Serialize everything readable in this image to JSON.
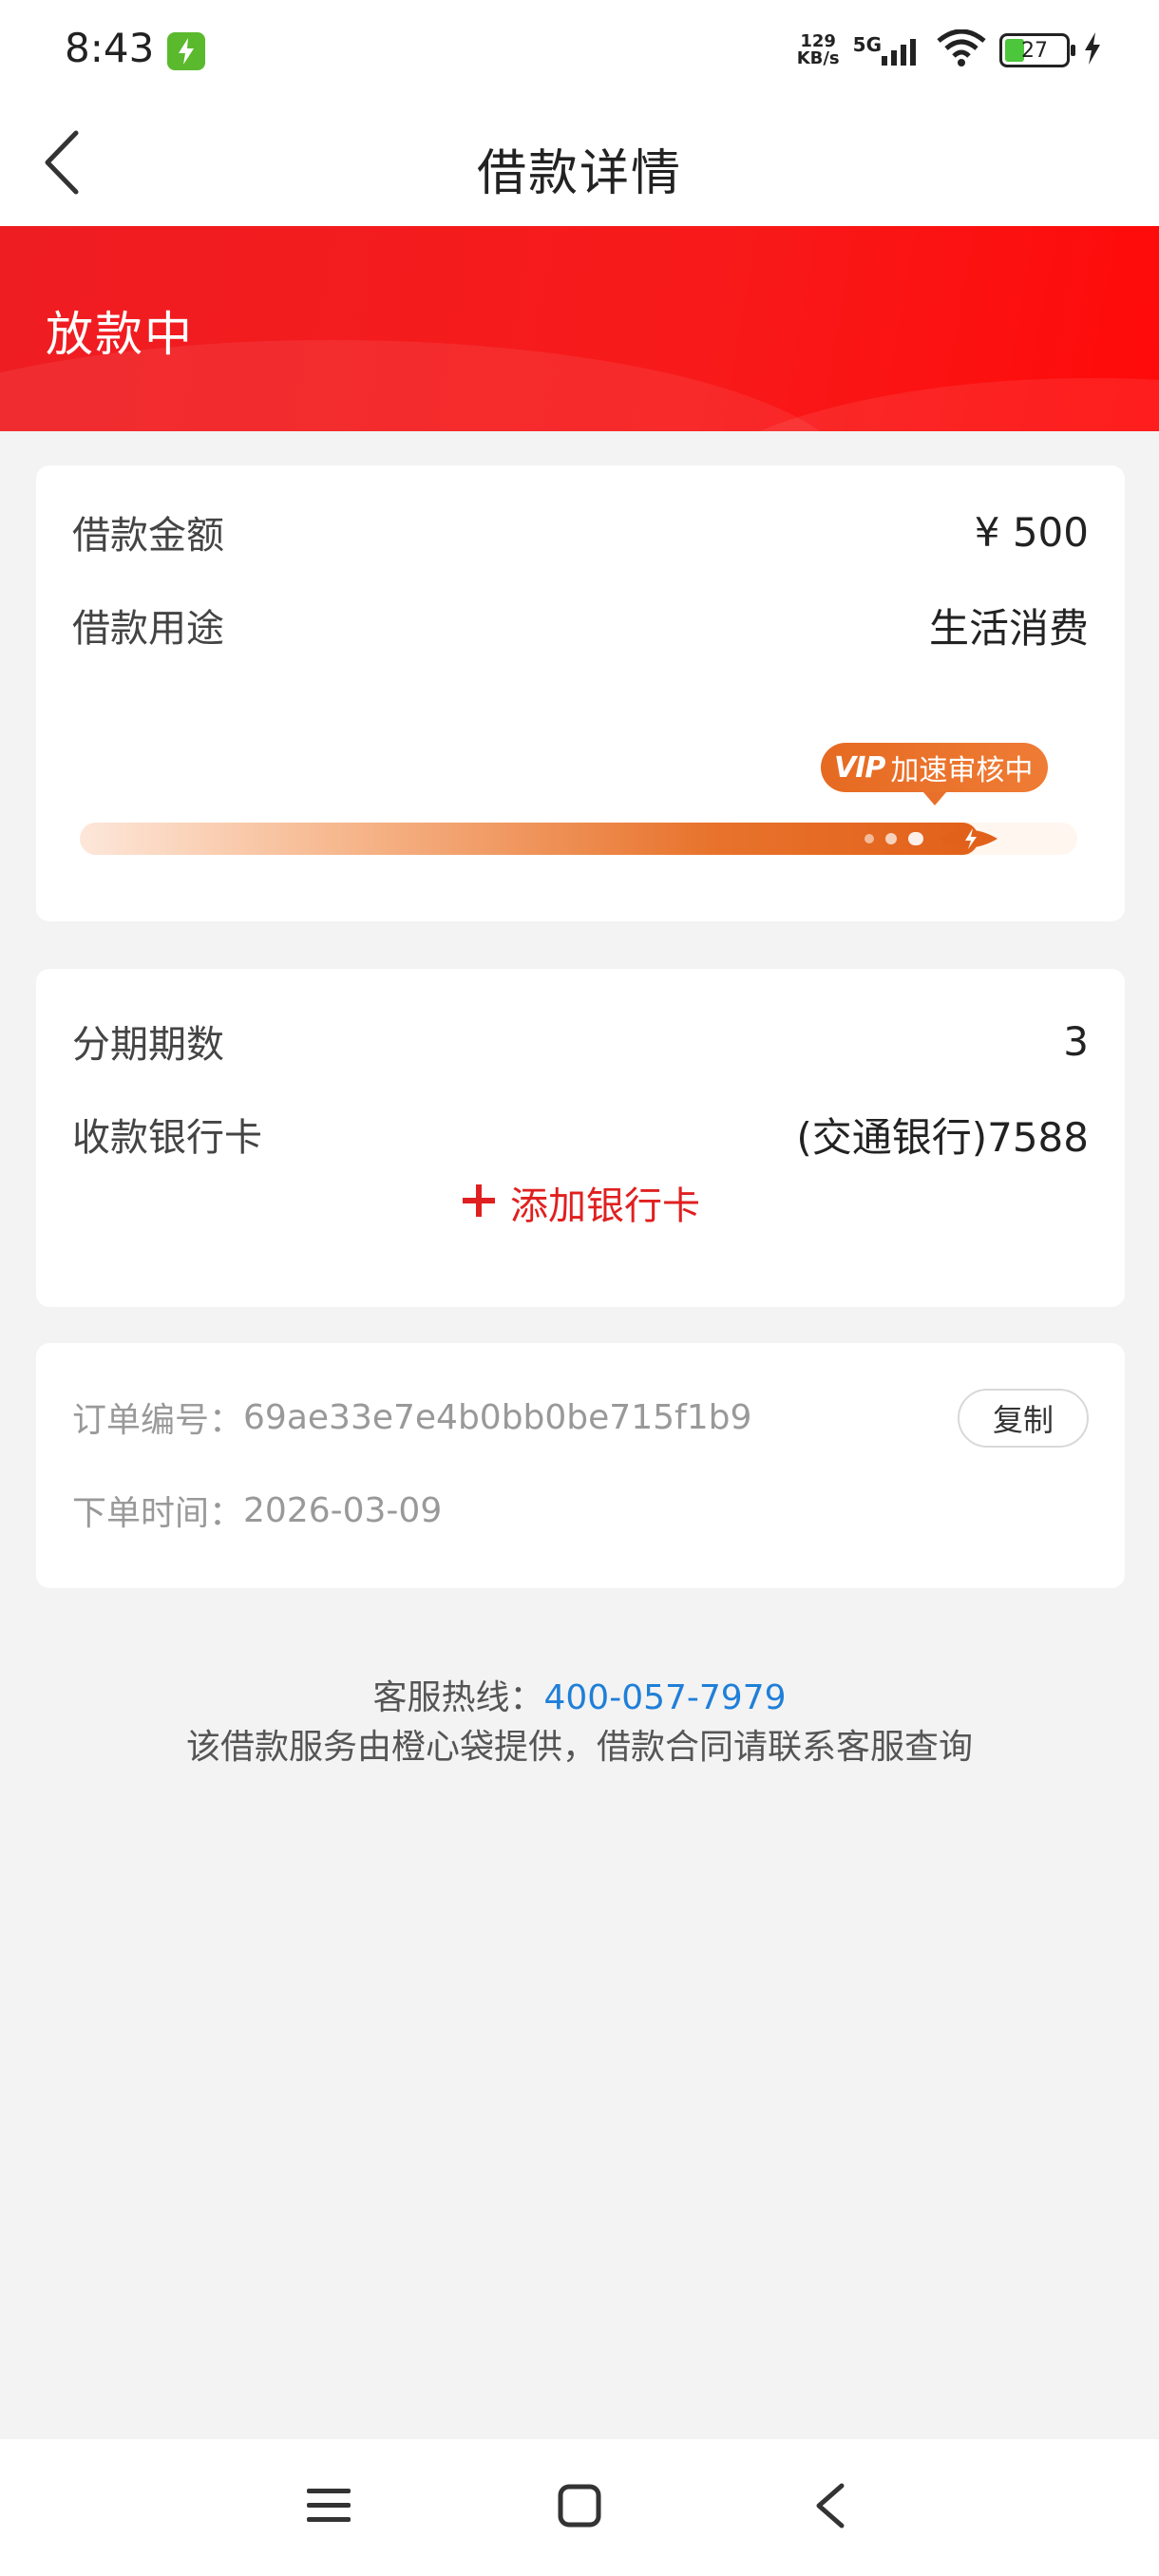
{
  "status_bar": {
    "time": "8:43",
    "net_speed_value": "129",
    "net_speed_unit": "KB/s",
    "network_type": "5G",
    "battery_level": "27",
    "icons": [
      "charging-app-icon",
      "signal-icon",
      "wifi-icon",
      "battery-icon",
      "charging-bolt-icon"
    ]
  },
  "header": {
    "title": "借款详情",
    "back_icon": "chevron-left-icon"
  },
  "banner": {
    "status": "放款中",
    "color": "#f41c1c"
  },
  "loan_card": {
    "amount_label": "借款金额",
    "amount_value": "¥ 500",
    "purpose_label": "借款用途",
    "purpose_value": "生活消费",
    "progress": {
      "fraction": 0.92,
      "badge_mark": "VIP",
      "badge_text": "加速审核中",
      "accent": "#e66a21"
    }
  },
  "installment_card": {
    "periods_label": "分期期数",
    "periods_value": "3",
    "bank_label": "收款银行卡",
    "bank_value": "(交通银行)7588",
    "add_card_label": "添加银行卡"
  },
  "order_card": {
    "order_no_label": "订单编号：",
    "order_no_value": "69ae33e7e4b0bb0be715f1b9",
    "copy_label": "复制",
    "order_time_label": "下单时间：",
    "order_time_value": "2026-03-09"
  },
  "footer": {
    "hotline_label": "客服热线：",
    "hotline_value": "400-057-7979",
    "hotline_color": "#1f7fd8",
    "notice": "该借款服务由橙心袋提供，借款合同请联系客服查询"
  },
  "nav_bar": {
    "icons": [
      "menu-icon",
      "home-square-icon",
      "back-triangle-icon"
    ]
  }
}
